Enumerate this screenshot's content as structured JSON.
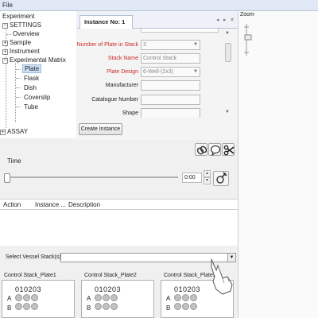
{
  "menubar": {
    "file": "File"
  },
  "tree": {
    "root": "Experiment",
    "settings": "SETTINGS",
    "overview": "Overview",
    "sample": "Sample",
    "instrument": "Instrument",
    "matrix": "Experimental Matrix",
    "plate": "Plate",
    "flask": "Flask",
    "dish": "Dish",
    "coverslip": "Coverslip",
    "tube": "Tube",
    "assay": "ASSAY"
  },
  "instance_tab": {
    "label": "Instance No: 1"
  },
  "form": {
    "num_plates_label": "Number of Plate in Stack",
    "num_plates_value": "3",
    "stack_name_label": "Stack Name",
    "stack_name_value": "Control Stack",
    "plate_design_label": "Plate Design",
    "plate_design_value": "6-Well-(2x3)",
    "manufacturer_label": "Manufacturer",
    "catalogue_label": "Catalogue Number",
    "shape_label": "Shape",
    "create_button": "Create Instance"
  },
  "zoom": {
    "label": "Zoom"
  },
  "time": {
    "label": "Time",
    "value": "0:00"
  },
  "action_table": {
    "col1": "Action",
    "col2": "Instance ...",
    "col3": "Description"
  },
  "vessel": {
    "label": "Select Vessel Stack(s)"
  },
  "plates": [
    {
      "title": "Control Stack_Plate1",
      "cols": "010203",
      "rowA": "A",
      "rowB": "B"
    },
    {
      "title": "Control Stack_Plate2",
      "cols": "010203",
      "rowA": "A",
      "rowB": "B"
    },
    {
      "title": "Control Stack_Plate3",
      "cols": "010203",
      "rowA": "A",
      "rowB": "B"
    }
  ],
  "colors": {
    "required_label": "#cc2b2b",
    "selection": "#cfe0f5",
    "well": "#c2c2c2"
  }
}
